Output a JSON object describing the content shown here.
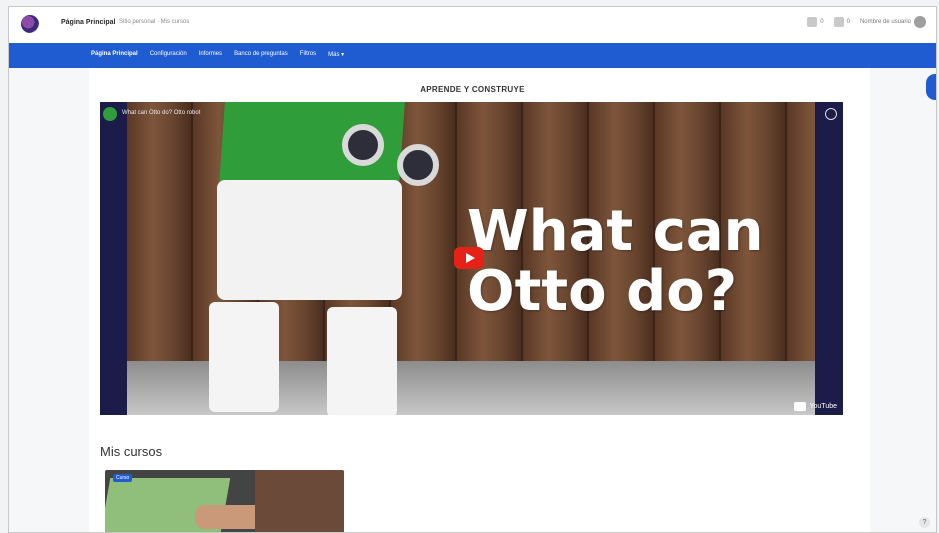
{
  "header": {
    "site_title": "Página Principal",
    "site_subtitle": "Sitio personal · Mis cursos",
    "right_items": [
      {
        "icon": "bell-icon",
        "label": "0"
      },
      {
        "icon": "chat-icon",
        "label": "0"
      }
    ],
    "user_name": "Nombre de usuario"
  },
  "nav": {
    "items": [
      {
        "label": "Página Principal",
        "active": true
      },
      {
        "label": "Configuración",
        "active": false
      },
      {
        "label": "Informes",
        "active": false
      },
      {
        "label": "Banco de preguntas",
        "active": false
      },
      {
        "label": "Filtros",
        "active": false
      },
      {
        "label": "Más ▾",
        "active": false
      }
    ]
  },
  "main": {
    "section_title": "APRENDE Y CONSTRUYE",
    "video": {
      "title": "What can Otto do? Otto robot",
      "overlay_line1": "What can",
      "overlay_line2": "Otto do?",
      "platform": "YouTube"
    },
    "my_courses_title": "Mis cursos",
    "course_card": {
      "badge": "Curso"
    }
  },
  "colors": {
    "nav_bg": "#1f5bd1",
    "accent": "#1f5bd1",
    "play": "#e62117"
  }
}
